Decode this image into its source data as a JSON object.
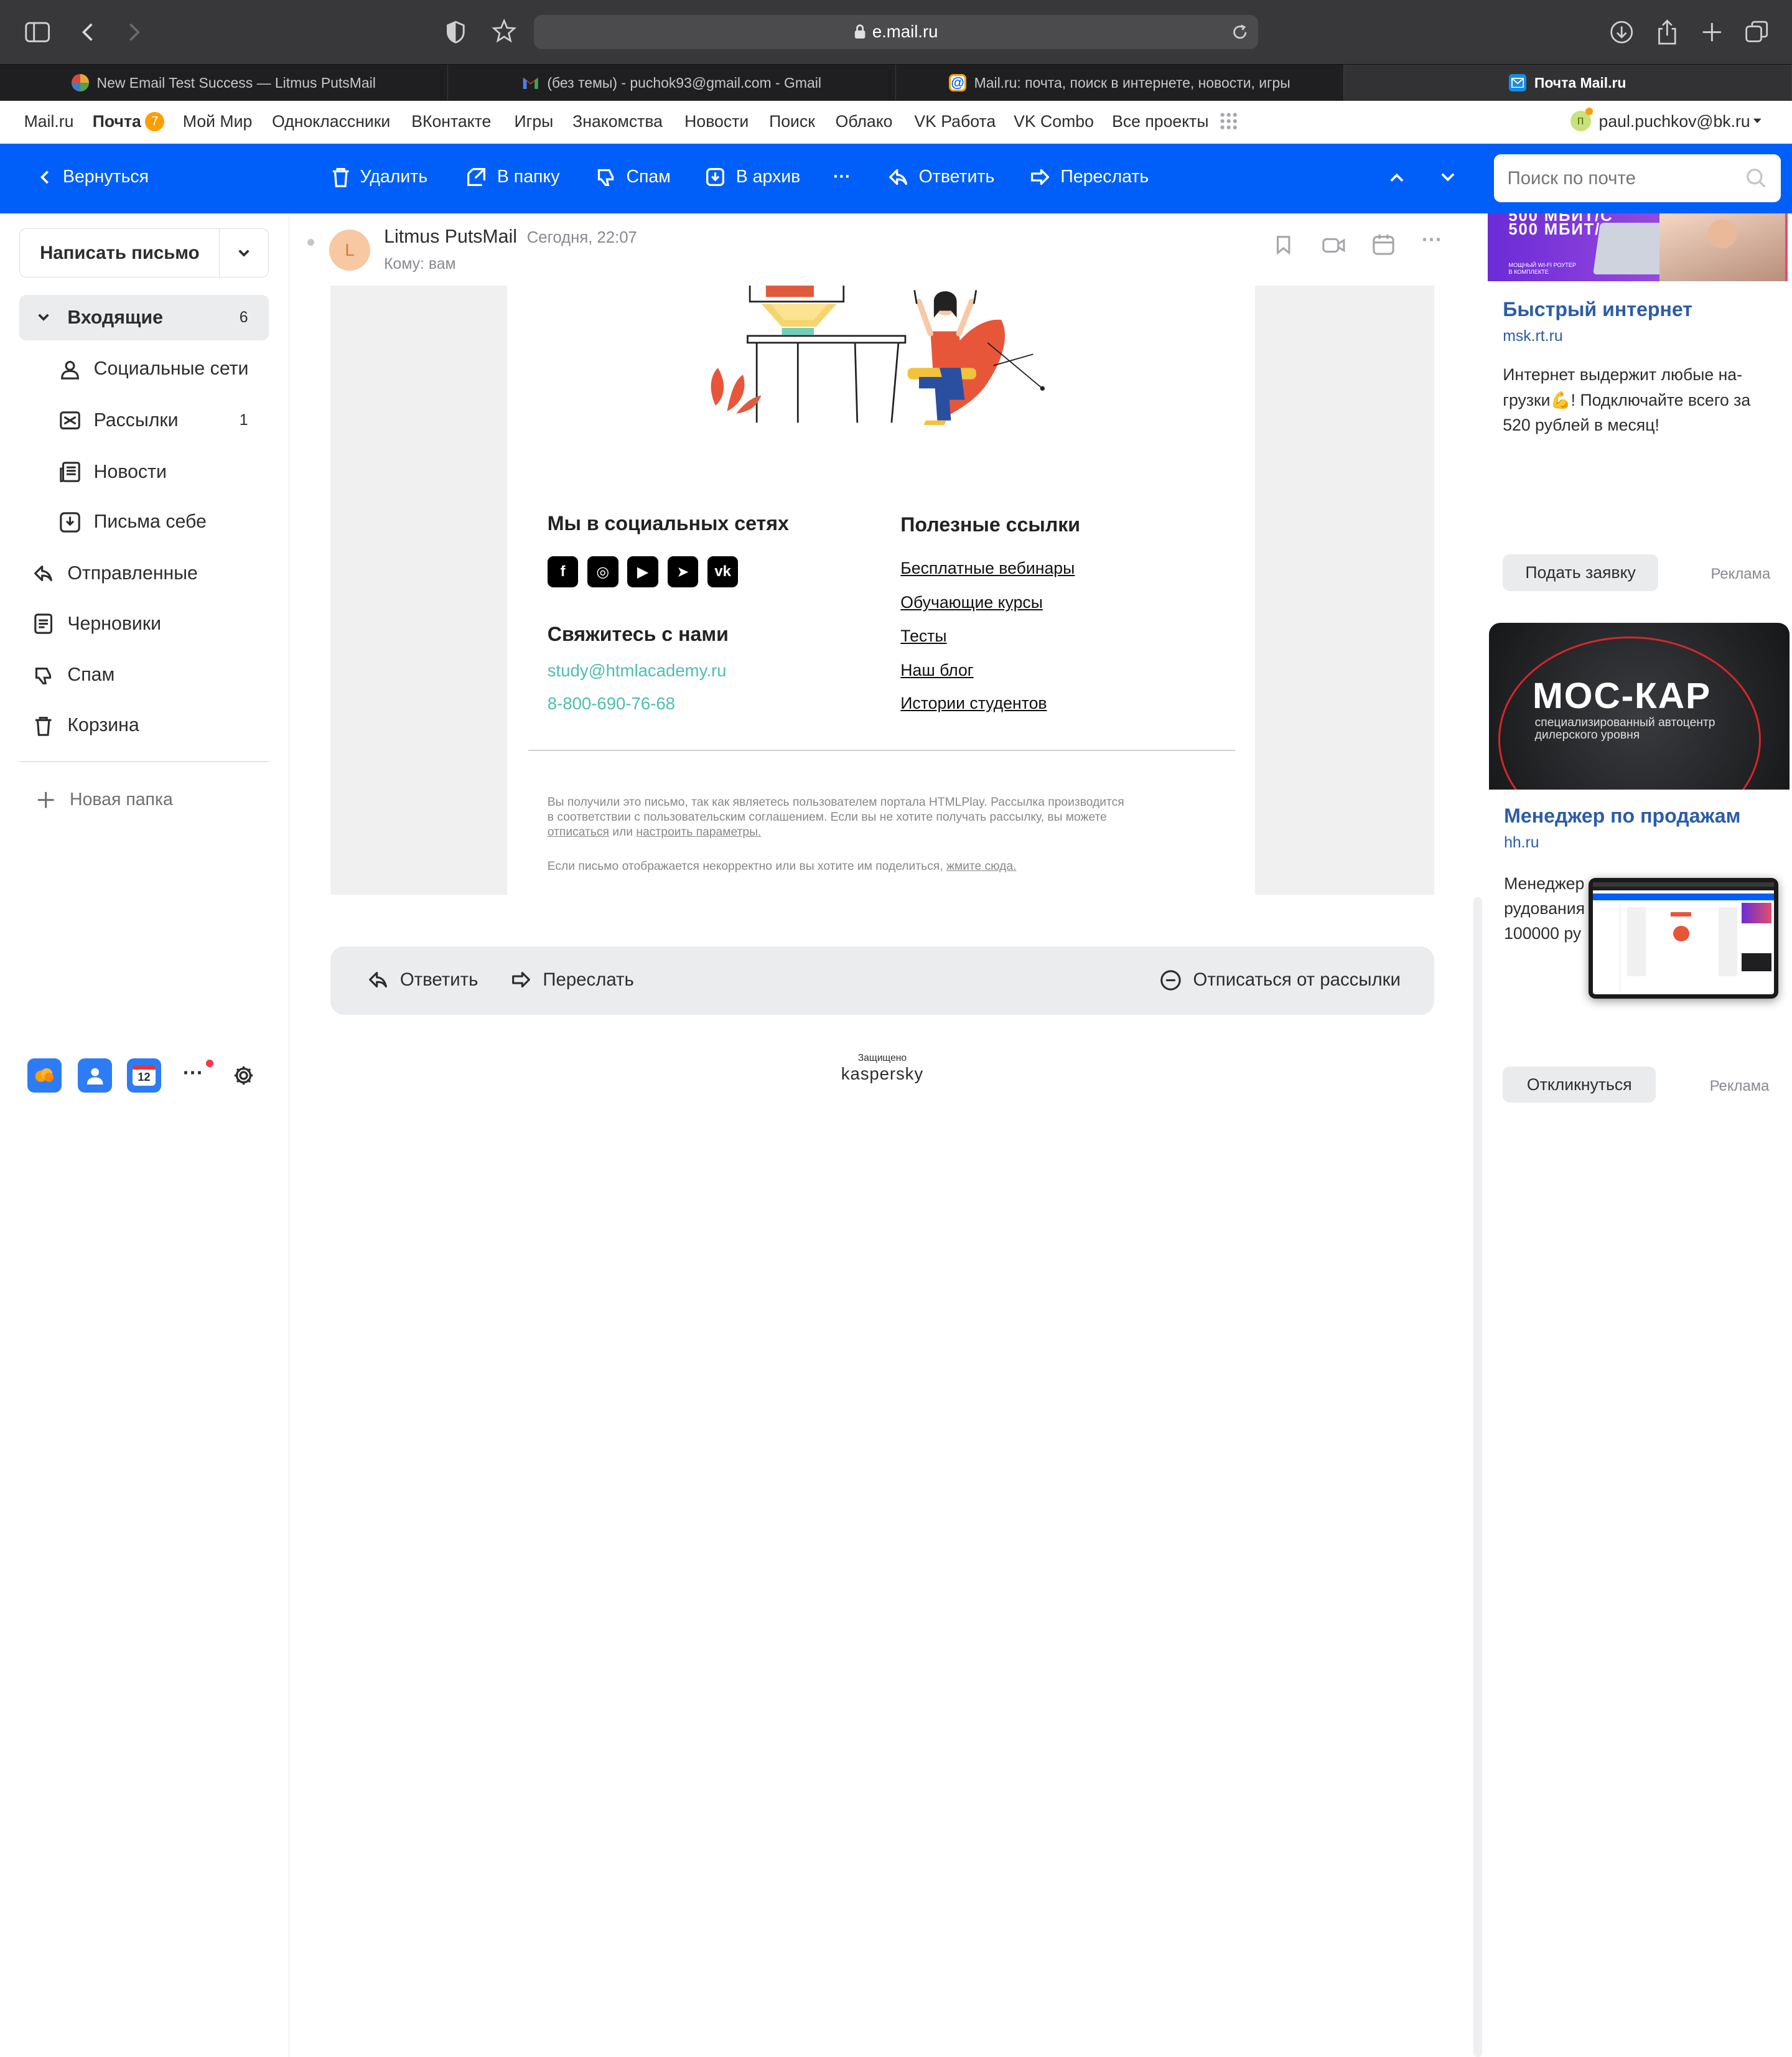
{
  "browser": {
    "url": "e.mail.ru"
  },
  "tabs": [
    {
      "label": "New Email Test Success — Litmus PutsMail",
      "favicon": "litmus"
    },
    {
      "label": "(без темы) - puchok93@gmail.com - Gmail",
      "favicon": "gmail"
    },
    {
      "label": "Mail.ru: почта, поиск в интернете, новости, игры",
      "favicon": "mailru"
    },
    {
      "label": "Почта Mail.ru",
      "favicon": "mailru-mail",
      "active": true
    }
  ],
  "portal": {
    "links": [
      "Mail.ru",
      "Почта",
      "Мой Мир",
      "Одноклассники",
      "ВКонтакте",
      "Игры",
      "Знакомства",
      "Новости",
      "Поиск",
      "Облако",
      "VK Работа",
      "VK Combo",
      "Все проекты"
    ],
    "mail_badge": "7",
    "user_initial": "п",
    "user": "paul.puchkov@bk.ru"
  },
  "toolbar": {
    "back": "Вернуться",
    "delete": "Удалить",
    "to_folder": "В папку",
    "spam": "Спам",
    "archive": "В архив",
    "more": "···",
    "reply": "Ответить",
    "forward": "Переслать",
    "search_placeholder": "Поиск по почте"
  },
  "sidebar": {
    "compose": "Написать письмо",
    "items": [
      {
        "label": "Входящие",
        "count": "6"
      },
      {
        "label": "Социальные сети",
        "count": ""
      },
      {
        "label": "Рассылки",
        "count": "1"
      },
      {
        "label": "Новости",
        "count": ""
      },
      {
        "label": "Письма себе",
        "count": ""
      },
      {
        "label": "Отправленные",
        "count": ""
      },
      {
        "label": "Черновики",
        "count": ""
      },
      {
        "label": "Спам",
        "count": ""
      },
      {
        "label": "Корзина",
        "count": ""
      }
    ],
    "new_folder": "Новая папка",
    "calendar_day": "12",
    "more": "···"
  },
  "email": {
    "sender_initial": "L",
    "sender": "Litmus PutsMail",
    "date": "Сегодня, 22:07",
    "to": "Кому: вам",
    "social_title": "Мы в социальных сетях",
    "social_icons": [
      "f",
      "◎",
      "▶",
      "➤",
      "vk"
    ],
    "contact_title": "Свяжитесь с нами",
    "contact_email": "study@htmlacademy.ru",
    "contact_phone": "8-800-690-76-68",
    "links_title": "Полезные ссылки",
    "links": [
      "Бесплатные вебинары",
      "Обучающие курсы",
      "Тесты",
      "Наш блог",
      "Истории студентов"
    ],
    "footer1": "Вы получили это письмо, так как являетесь пользователем портала HTMLPlay. Рассылка производится",
    "footer2": "в соответствии с пользовательским соглашением. Если вы не хотите получать рассылку, вы можете",
    "footer3_link1": "отписаться",
    "footer3_mid": " или ",
    "footer3_link2": "настроить параметры.",
    "footer4": "Если письмо отображается некорректно или вы хотите им поделиться, ",
    "footer4_link": "жмите сюда.",
    "reply": "Ответить",
    "forward": "Переслать",
    "unsubscribe": "Отписаться от рассылки",
    "protected": "Защищено",
    "kaspersky": "kaspersky"
  },
  "ads": {
    "ad1_banner": "500 МБИТ/С",
    "ad1_banner_sub": "МОЩНЫЙ WI-FI РОУТЕР В КОМПЛЕКТЕ",
    "ad1_title": "Быстрый интернет",
    "ad1_domain": "msk.rt.ru",
    "ad1_text": "Интернет выдержит любые на-грузки💪! Подключайте всего за 520 рублей в месяц!",
    "ad1_button": "Подать заявку",
    "ad_label": "Реклама",
    "ad2_logo": "МОС-КАР",
    "ad2_sub1": "специализированный автоцентр",
    "ad2_sub2": "дилерского уровня",
    "ad2_title": "Менеджер по продажам",
    "ad2_domain": "hh.ru",
    "ad2_text1": "Менеджер",
    "ad2_text2": "рудования",
    "ad2_text3": "100000 ру",
    "ad2_button": "Откликнуться"
  }
}
